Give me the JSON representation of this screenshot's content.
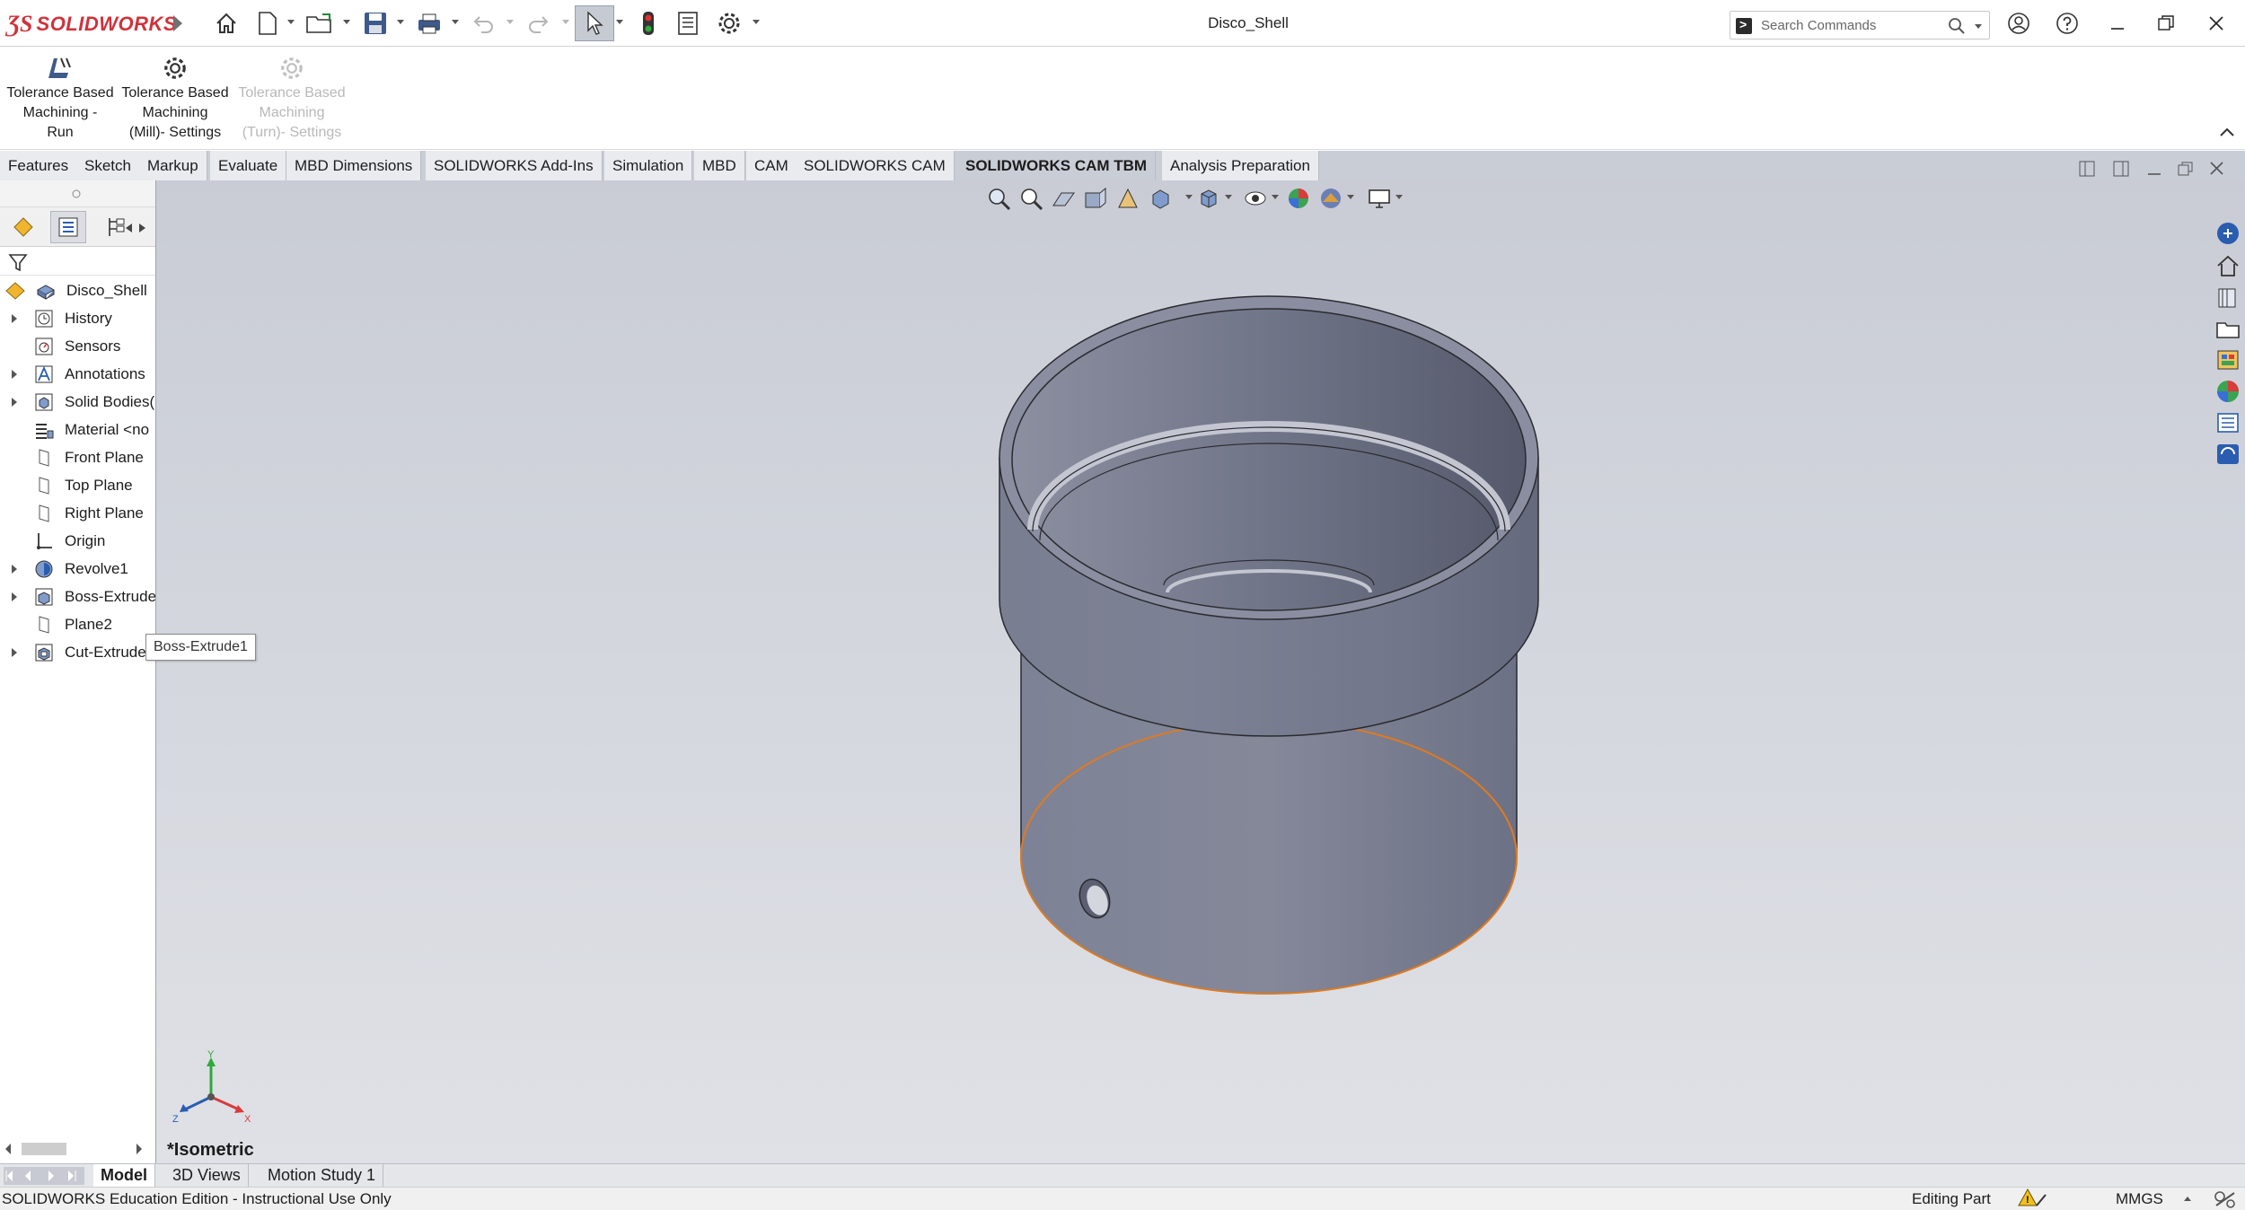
{
  "app": {
    "logo_text": "SOLIDWORKS",
    "document_title": "Disco_Shell"
  },
  "search": {
    "placeholder": "Search Commands"
  },
  "ribbon": {
    "commands": [
      {
        "lines": [
          "Tolerance Based",
          "Machining -",
          "Run"
        ],
        "enabled": true,
        "icon": "tbm-run-icon"
      },
      {
        "lines": [
          "Tolerance Based",
          "Machining",
          "(Mill)- Settings"
        ],
        "enabled": true,
        "icon": "gear-icon"
      },
      {
        "lines": [
          "Tolerance Based",
          "Machining",
          "(Turn)- Settings"
        ],
        "enabled": false,
        "icon": "gear-icon"
      }
    ]
  },
  "tabs": [
    {
      "label": "Features"
    },
    {
      "label": "Sketch"
    },
    {
      "label": "Markup"
    },
    {
      "label": "Evaluate"
    },
    {
      "label": "MBD Dimensions"
    },
    {
      "label": "SOLIDWORKS Add-Ins"
    },
    {
      "label": "Simulation"
    },
    {
      "label": "MBD"
    },
    {
      "label": "CAM"
    },
    {
      "label": "SOLIDWORKS CAM"
    },
    {
      "label": "SOLIDWORKS CAM TBM",
      "active": true
    },
    {
      "label": "Analysis Preparation"
    }
  ],
  "tree": {
    "root": "Disco_Shell",
    "items": [
      {
        "label": "History",
        "expandable": true,
        "icon": "history-icon"
      },
      {
        "label": "Sensors",
        "expandable": false,
        "icon": "sensors-icon"
      },
      {
        "label": "Annotations",
        "expandable": true,
        "icon": "annotations-icon"
      },
      {
        "label": "Solid Bodies(",
        "expandable": true,
        "icon": "solid-bodies-icon"
      },
      {
        "label": "Material <no",
        "expandable": false,
        "icon": "material-icon"
      },
      {
        "label": "Front Plane",
        "expandable": false,
        "icon": "plane-icon"
      },
      {
        "label": "Top Plane",
        "expandable": false,
        "icon": "plane-icon"
      },
      {
        "label": "Right Plane",
        "expandable": false,
        "icon": "plane-icon"
      },
      {
        "label": "Origin",
        "expandable": false,
        "icon": "origin-icon"
      },
      {
        "label": "Revolve1",
        "expandable": true,
        "icon": "revolve-icon"
      },
      {
        "label": "Boss-Extrude",
        "expandable": true,
        "icon": "extrude-icon"
      },
      {
        "label": "Plane2",
        "expandable": false,
        "icon": "plane-icon"
      },
      {
        "label": "Cut-Extrude",
        "expandable": true,
        "icon": "cut-extrude-icon",
        "selected": true
      }
    ]
  },
  "tooltip": {
    "text": "Boss-Extrude1"
  },
  "viewport": {
    "view_name": "*Isometric"
  },
  "triad": {
    "x": "X",
    "y": "Y",
    "z": "Z"
  },
  "bottom_tabs": [
    {
      "label": "Model",
      "active": true
    },
    {
      "label": "3D Views"
    },
    {
      "label": "Motion Study 1"
    }
  ],
  "status": {
    "edition": "SOLIDWORKS Education Edition - Instructional Use Only",
    "mode": "Editing Part",
    "units": "MMGS"
  },
  "colors": {
    "accent": "#d1323b",
    "selection_blue": "#2563c9",
    "model_edge_highlight": "#e07a1f"
  }
}
